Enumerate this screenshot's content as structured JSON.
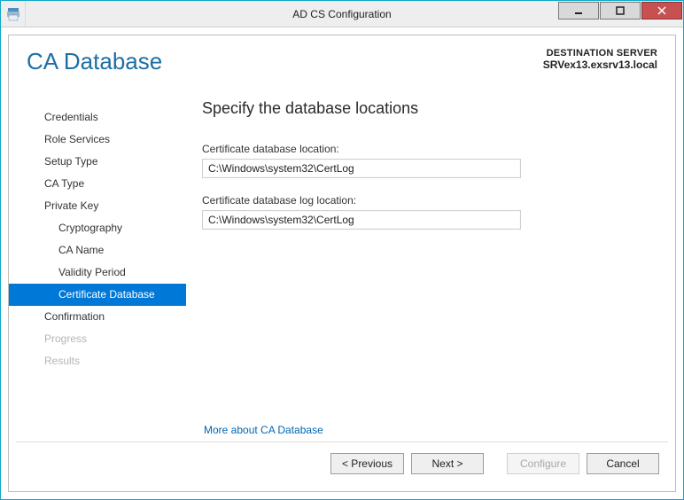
{
  "window": {
    "title": "AD CS Configuration"
  },
  "header": {
    "page_title": "CA Database",
    "dest_label": "DESTINATION SERVER",
    "dest_value": "SRVex13.exsrv13.local"
  },
  "sidebar": {
    "items": [
      {
        "label": "Credentials",
        "child": false,
        "selected": false,
        "disabled": false
      },
      {
        "label": "Role Services",
        "child": false,
        "selected": false,
        "disabled": false
      },
      {
        "label": "Setup Type",
        "child": false,
        "selected": false,
        "disabled": false
      },
      {
        "label": "CA Type",
        "child": false,
        "selected": false,
        "disabled": false
      },
      {
        "label": "Private Key",
        "child": false,
        "selected": false,
        "disabled": false
      },
      {
        "label": "Cryptography",
        "child": true,
        "selected": false,
        "disabled": false
      },
      {
        "label": "CA Name",
        "child": true,
        "selected": false,
        "disabled": false
      },
      {
        "label": "Validity Period",
        "child": true,
        "selected": false,
        "disabled": false
      },
      {
        "label": "Certificate Database",
        "child": true,
        "selected": true,
        "disabled": false
      },
      {
        "label": "Confirmation",
        "child": false,
        "selected": false,
        "disabled": false
      },
      {
        "label": "Progress",
        "child": false,
        "selected": false,
        "disabled": true
      },
      {
        "label": "Results",
        "child": false,
        "selected": false,
        "disabled": true
      }
    ]
  },
  "main": {
    "section_title": "Specify the database locations",
    "db_label": "Certificate database location:",
    "db_value": "C:\\Windows\\system32\\CertLog",
    "log_label": "Certificate database log location:",
    "log_value": "C:\\Windows\\system32\\CertLog",
    "more_link": "More about CA Database"
  },
  "footer": {
    "previous": "< Previous",
    "next": "Next >",
    "configure": "Configure",
    "cancel": "Cancel"
  }
}
